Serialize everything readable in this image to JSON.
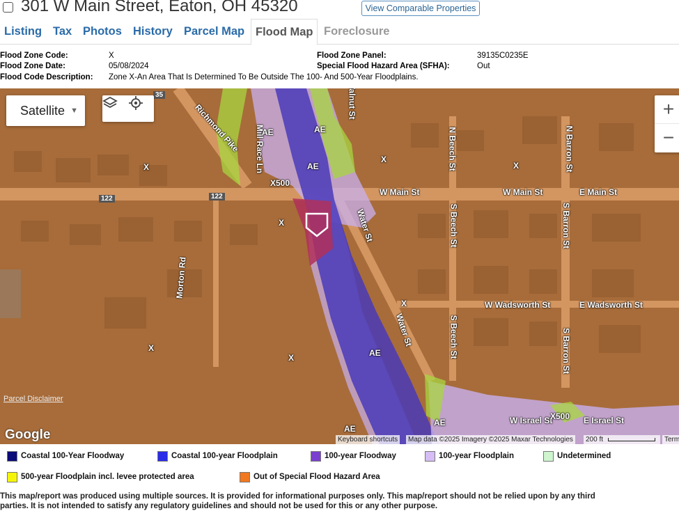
{
  "header": {
    "address": "301 W Main Street, Eaton, OH 45320",
    "comparable_button": "View Comparable Properties"
  },
  "tabs": [
    {
      "label": "Listing"
    },
    {
      "label": "Tax"
    },
    {
      "label": "Photos"
    },
    {
      "label": "History"
    },
    {
      "label": "Parcel Map"
    },
    {
      "label": "Flood Map",
      "active": true
    },
    {
      "label": "Foreclosure",
      "disabled": true
    }
  ],
  "flood_info": {
    "zone_code_label": "Flood Zone Code:",
    "zone_code": "X",
    "zone_date_label": "Flood Zone Date:",
    "zone_date": "05/08/2024",
    "code_desc_label": "Flood Code Description:",
    "code_desc": "Zone X-An Area That Is Determined To Be Outside The 100- And 500-Year Floodplains.",
    "panel_label": "Flood Zone Panel:",
    "panel": "39135C0235E",
    "sfha_label": "Special Flood Hazard Area (SFHA):",
    "sfha": "Out"
  },
  "map": {
    "map_type": "Satellite",
    "zoom_in": "+",
    "zoom_out": "−",
    "google": "Google",
    "keyboard": "Keyboard shortcuts",
    "map_data": "Map data ©2025 Imagery ©2025 Maxar Technologies",
    "scale": "200 ft",
    "terms": "Terms",
    "parcel_disclaimer": "Parcel Disclaimer",
    "labels": {
      "richmond": "Richmond Pike",
      "mill_race": "Mill Race Ln",
      "walnut": "Walnut St",
      "n_beech": "N Beech St",
      "n_barron": "N Barron St",
      "w_main_1": "W Main St",
      "w_main_2": "W Main St",
      "e_main": "E Main St",
      "water_1": "Water St",
      "water_2": "Water St",
      "s_beech_1": "S Beech St",
      "s_beech_2": "S Beech St",
      "s_barron_1": "S Barron St",
      "s_barron_2": "S Barron St",
      "w_wadsworth": "W Wadsworth St",
      "e_wadsworth": "E Wadsworth St",
      "morton": "Morton Rd",
      "w_israel": "W Israel St",
      "e_israel": "E Israel St",
      "route": "122",
      "route2": "122",
      "route3": "35",
      "x500_a": "X500",
      "x500_b": "X500",
      "ae_a": "AE",
      "ae_b": "AE",
      "ae_c": "AE",
      "ae_d": "AE",
      "ae_e": "AE",
      "ae_f": "AE",
      "x_a": "X",
      "x_b": "X",
      "x_c": "X",
      "x_d": "X",
      "x_e": "X",
      "x_f": "X",
      "x_g": "X"
    }
  },
  "legend": [
    {
      "label": "Coastal 100-Year Floodway",
      "color": "#0b0b7a"
    },
    {
      "label": "Coastal 100-year Floodplain",
      "color": "#2b2be8"
    },
    {
      "label": "100-year Floodway",
      "color": "#7a3fd0"
    },
    {
      "label": "100-year Floodplain",
      "color": "#d6bdf5"
    },
    {
      "label": "Undetermined",
      "color": "#cff5cf"
    },
    {
      "label": "500-year Floodplain incl. levee protected area",
      "color": "#f5f50a"
    },
    {
      "label": "Out of Special Flood Hazard Area",
      "color": "#f07820"
    }
  ],
  "disclaimer": {
    "line1": "This map/report was produced using multiple sources. It is provided for informational purposes only. This map/report should not be relied upon by any third",
    "line2": "parties. It is not intended to satisfy any regulatory guidelines and should not be used for this or any other purpose."
  }
}
